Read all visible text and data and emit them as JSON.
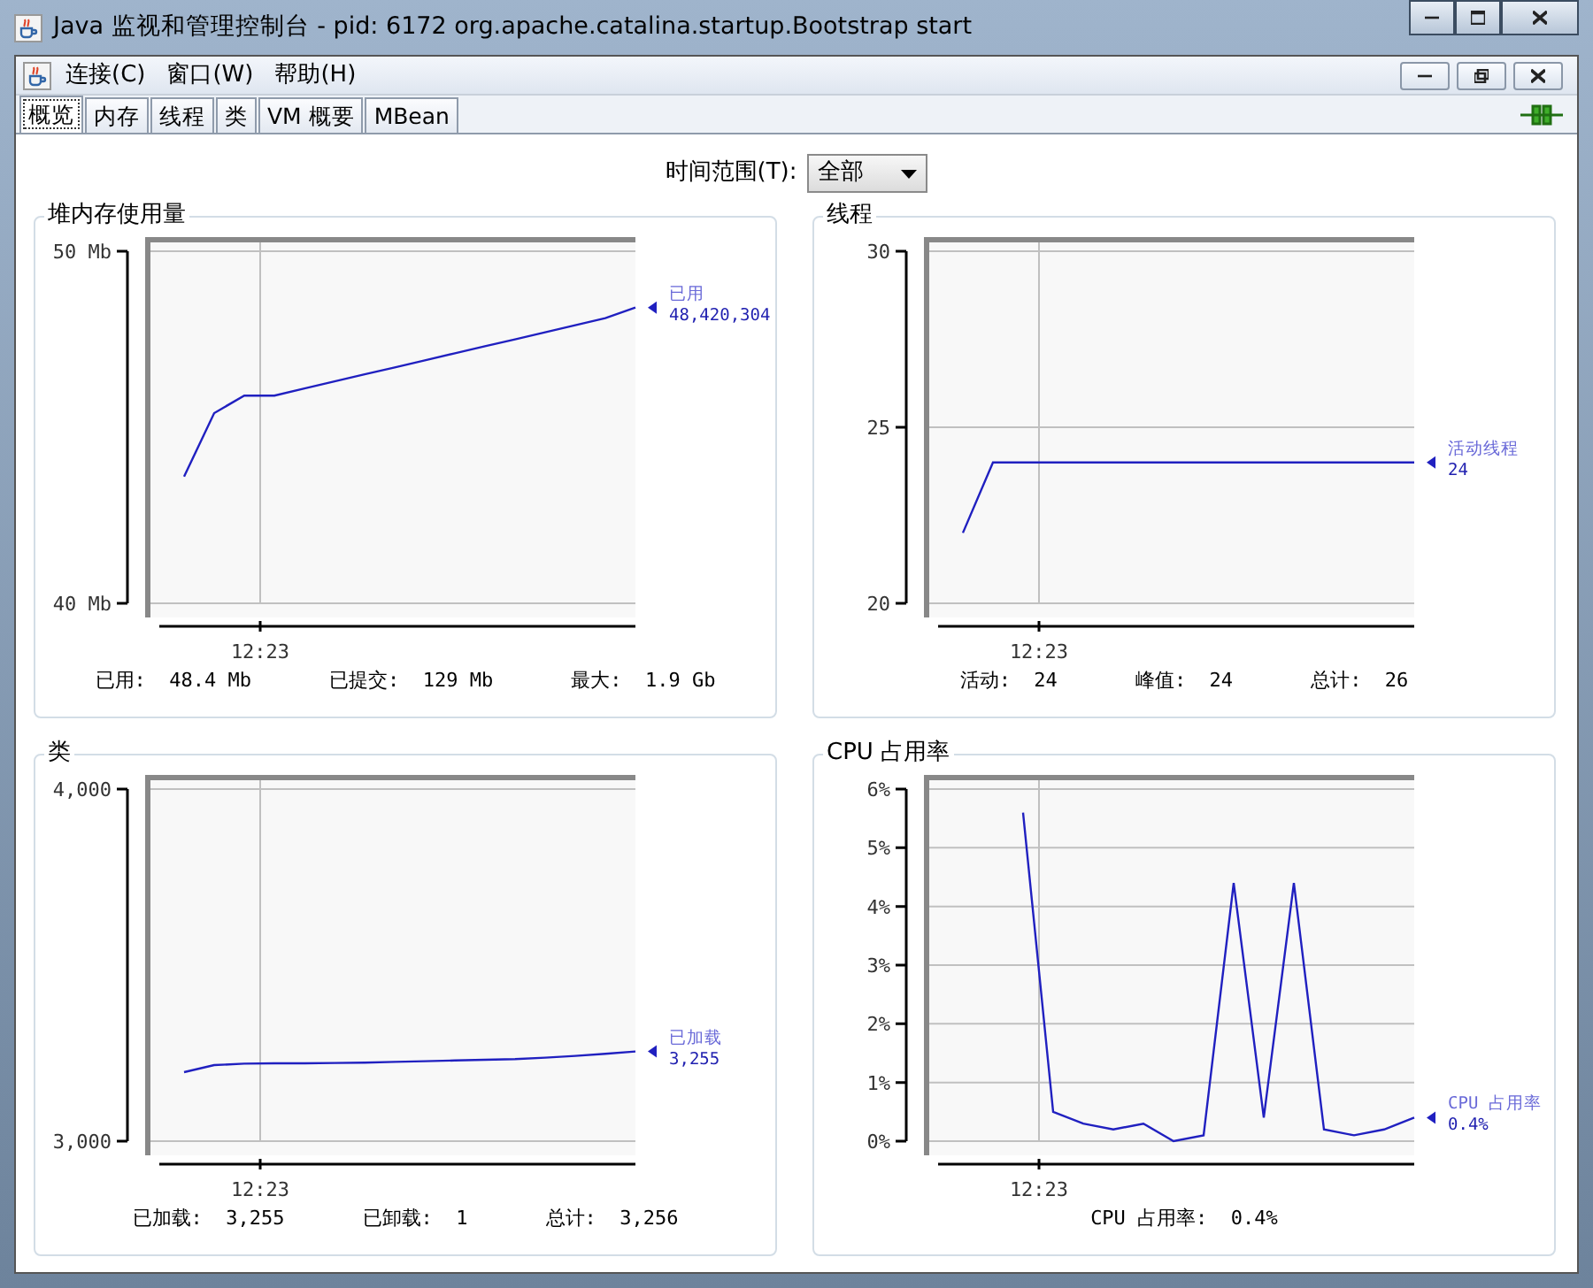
{
  "window": {
    "title": "Java 监视和管理控制台 - pid: 6172 org.apache.catalina.startup.Bootstrap start"
  },
  "menu": [
    {
      "label": "连接(C)"
    },
    {
      "label": "窗口(W)"
    },
    {
      "label": "帮助(H)"
    }
  ],
  "tabs": [
    {
      "label": "概览",
      "selected": true
    },
    {
      "label": "内存",
      "selected": false
    },
    {
      "label": "线程",
      "selected": false
    },
    {
      "label": "类",
      "selected": false
    },
    {
      "label": "VM 概要",
      "selected": false
    },
    {
      "label": "MBean",
      "selected": false
    }
  ],
  "time_range": {
    "label": "时间范围(T):",
    "value": "全部"
  },
  "panels": [
    {
      "title": "堆内存使用量",
      "legend_value": "48,420,304",
      "stats": [
        {
          "label": "已用:",
          "value": "48.4 Mb"
        },
        {
          "label": "已提交:",
          "value": "129 Mb"
        },
        {
          "label": "最大:",
          "value": "1.9 Gb"
        }
      ],
      "time_label": "12:23",
      "chart_data": {
        "type": "line",
        "grid": true,
        "ylim": [
          40,
          50
        ],
        "yticks": [
          {
            "value": 40,
            "label": "40 Mb"
          },
          {
            "value": 50,
            "label": "50 Mb"
          }
        ],
        "series": [
          {
            "name": "已用",
            "color": "#2020c0",
            "values": [
              43.6,
              45.4,
              45.9,
              45.9,
              46.1,
              46.3,
              46.5,
              46.7,
              46.9,
              47.1,
              47.3,
              47.5,
              47.7,
              47.9,
              48.1,
              48.4
            ]
          }
        ]
      }
    },
    {
      "title": "线程",
      "legend_value": "24",
      "stats": [
        {
          "label": "活动:",
          "value": "24"
        },
        {
          "label": "峰值:",
          "value": "24"
        },
        {
          "label": "总计:",
          "value": "26"
        }
      ],
      "time_label": "12:23",
      "chart_data": {
        "type": "line",
        "grid": true,
        "ylim": [
          20,
          30
        ],
        "yticks": [
          {
            "value": 20,
            "label": "20"
          },
          {
            "value": 25,
            "label": "25"
          },
          {
            "value": 30,
            "label": "30"
          }
        ],
        "series": [
          {
            "name": "活动线程",
            "color": "#2020c0",
            "values": [
              22,
              24,
              24,
              24,
              24,
              24,
              24,
              24,
              24,
              24,
              24,
              24,
              24,
              24,
              24,
              24
            ]
          }
        ]
      }
    },
    {
      "title": "类",
      "legend_value": "3,255",
      "stats": [
        {
          "label": "已加载:",
          "value": "3,255"
        },
        {
          "label": "已卸载:",
          "value": "1"
        },
        {
          "label": "总计:",
          "value": "3,256"
        }
      ],
      "time_label": "12:23",
      "chart_data": {
        "type": "line",
        "grid": true,
        "ylim": [
          3000,
          4000
        ],
        "yticks": [
          {
            "value": 3000,
            "label": "3,000"
          },
          {
            "value": 4000,
            "label": "4,000"
          }
        ],
        "series": [
          {
            "name": "已加载",
            "color": "#2020c0",
            "values": [
              3196,
              3216,
              3220,
              3221,
              3221,
              3222,
              3223,
              3225,
              3227,
              3229,
              3231,
              3233,
              3237,
              3242,
              3248,
              3255
            ]
          }
        ]
      }
    },
    {
      "title": "CPU 占用率",
      "legend_value": "0.4%",
      "stats": [
        {
          "label": "CPU 占用率:",
          "value": "0.4%"
        }
      ],
      "time_label": "12:23",
      "chart_data": {
        "type": "line",
        "grid": true,
        "ylim": [
          0,
          6
        ],
        "yticks": [
          {
            "value": 0,
            "label": "0%"
          },
          {
            "value": 1,
            "label": "1%"
          },
          {
            "value": 2,
            "label": "2%"
          },
          {
            "value": 3,
            "label": "3%"
          },
          {
            "value": 4,
            "label": "4%"
          },
          {
            "value": 5,
            "label": "5%"
          },
          {
            "value": 6,
            "label": "6%"
          }
        ],
        "series": [
          {
            "name": "CPU 占用率",
            "color": "#2020c0",
            "values": [
              5.6,
              0.5,
              0.3,
              0.2,
              0.3,
              0.0,
              0.1,
              4.4,
              0.4,
              4.4,
              0.2,
              0.1,
              0.2,
              0.4
            ]
          }
        ]
      }
    }
  ]
}
